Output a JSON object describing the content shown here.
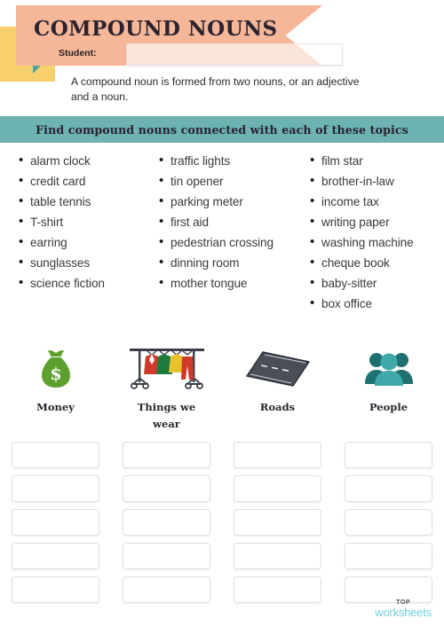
{
  "header": {
    "title": "COMPOUND NOUNS",
    "student_label": "Student:",
    "student_value": "",
    "student_placeholder": "",
    "intro": "A compound noun is formed from two nouns, or an adjective and a noun."
  },
  "instruction": {
    "text": "Find compound nouns connected with each of these topics"
  },
  "word_lists": {
    "columns": [
      {
        "items": [
          "alarm clock",
          "credit card",
          "table tennis",
          "T-shirt",
          "earring",
          "sunglasses",
          "science fiction"
        ]
      },
      {
        "items": [
          "traffic lights",
          "tin opener",
          "parking meter",
          "first aid",
          "pedestrian crossing",
          "dinning room",
          "mother tongue"
        ]
      },
      {
        "items": [
          "film star",
          "brother-in-law",
          "income tax",
          "writing paper",
          "washing machine",
          "cheque book",
          "baby-sitter",
          "box office"
        ]
      }
    ]
  },
  "categories": [
    {
      "label": "Money",
      "icon": "money-bag-icon",
      "color": "#5da02e"
    },
    {
      "label": "Things we wear",
      "icon": "clothes-rack-icon",
      "color": "#cf3a2b"
    },
    {
      "label": "Roads",
      "icon": "road-icon",
      "color": "#4a4f57"
    },
    {
      "label": "People",
      "icon": "people-group-icon",
      "color": "#2d8f8f"
    }
  ],
  "answer_grid": {
    "rows": 5,
    "cols": 4,
    "values": [
      [
        "",
        "",
        "",
        ""
      ],
      [
        "",
        "",
        "",
        ""
      ],
      [
        "",
        "",
        "",
        ""
      ],
      [
        "",
        "",
        "",
        ""
      ],
      [
        "",
        "",
        "",
        ""
      ]
    ],
    "placeholder": ""
  },
  "footer": {
    "top": "TOP",
    "worksheets": "worksheets",
    "accent": "#6fcfdc"
  },
  "colors": {
    "banner": "#f6b799",
    "yellow": "#f8cf6d",
    "teal": "#6cb3b1",
    "ink": "#2b2430"
  }
}
